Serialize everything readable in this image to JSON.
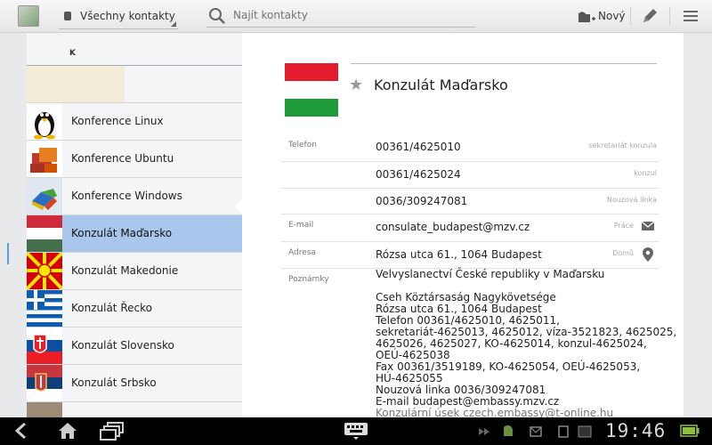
{
  "toolbar": {
    "account_label": "Všechny kontakty",
    "search_placeholder": "Najít kontakty",
    "new_label": "Nový"
  },
  "list": {
    "section_header": "K",
    "items": [
      {
        "name": ""
      },
      {
        "name": "Konference Linux"
      },
      {
        "name": "Konference Ubuntu"
      },
      {
        "name": "Konference Windows"
      },
      {
        "name": "Konzulát Maďarsko"
      },
      {
        "name": "Konzulát Makedonie"
      },
      {
        "name": "Konzulát Řecko"
      },
      {
        "name": "Konzulát Slovensko"
      },
      {
        "name": "Konzulát Srbsko"
      }
    ]
  },
  "detail": {
    "name": "Konzulát Maďarsko",
    "phone_label": "Telefon",
    "phones": [
      {
        "number": "00361/4625010",
        "type": "sekretariát konzula"
      },
      {
        "number": "00361/4625024",
        "type": "konzul"
      },
      {
        "number": "0036/309247081",
        "type": "Nouzová linka"
      }
    ],
    "email_label": "E-mail",
    "email": "consulate_budapest@mzv.cz",
    "email_type": "Práce",
    "address_label": "Adresa",
    "address": "Rózsa utca 61., 1064 Budapest",
    "address_type": "Domů",
    "notes_label": "Poznámky",
    "notes": [
      "Velvyslanectví České republiky v Maďarsku",
      "",
      "Cseh Köztársaság Nagykövetsége",
      "Rózsa utca 61., 1064 Budapest",
      "Telefon    00361/4625010, 4625011,",
      "sekretariát-4625013, 4625012, víza-3521823, 4625025,",
      "4625026, 4625027, KO-4625014, konzul-4625024,",
      "OEÚ-4625038",
      "Fax  00361/3519189, KO-4625054, OEÚ-4625053,",
      "HÚ-4625055",
      "Nouzová linka 0036/309247081",
      "E-mail  budapest@embassy.mzv.cz",
      "Konzulární úsek  czech.embassy@t-online.hu"
    ]
  },
  "system": {
    "clock": "19:46"
  }
}
